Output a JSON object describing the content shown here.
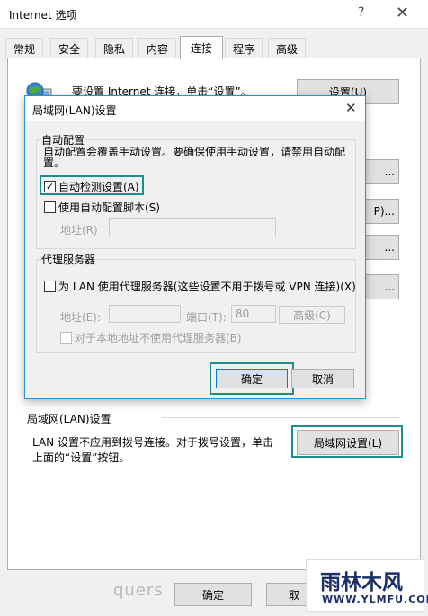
{
  "outer_window": {
    "title": "Internet 选项",
    "help_glyph": "?",
    "close_glyph": "✕"
  },
  "tabs": [
    "常规",
    "安全",
    "隐私",
    "内容",
    "连接",
    "程序",
    "高级"
  ],
  "active_tab": "连接",
  "setup": {
    "text": "要设置 Internet 连接，单击“设置”。",
    "button": "设置(U)"
  },
  "edge_buttons": [
    "...",
    "P)...",
    "...",
    "..."
  ],
  "lan_section": {
    "title": "局域网(LAN)设置",
    "description": "LAN 设置不应用到拨号连接。对于拨号设置，单击上面的“设置”按钮。",
    "button": "局域网设置(L)"
  },
  "outer_buttons": {
    "ok": "确定",
    "cancel": "取"
  },
  "watermark": {
    "quers": "quers",
    "logo": "雨林木风",
    "url": "WWW.YLMFU.COM"
  },
  "lan_dialog": {
    "title": "局域网(LAN)设置",
    "close_glyph": "✕",
    "auto_config": {
      "group_title": "自动配置",
      "description": "自动配置会覆盖手动设置。要确保使用手动设置，请禁用自动配置。",
      "auto_detect": {
        "label": "自动检测设置(A)",
        "checked": true,
        "mark": "✓"
      },
      "use_script": {
        "label": "使用自动配置脚本(S)",
        "checked": false
      },
      "address_label": "地址(R)",
      "address_value": ""
    },
    "proxy": {
      "group_title": "代理服务器",
      "use_proxy": {
        "label": "为 LAN 使用代理服务器(这些设置不用于拨号或 VPN 连接)(X)",
        "checked": false
      },
      "address_label": "地址(E):",
      "address_value": "",
      "port_label": "端口(T):",
      "port_value": "80",
      "advanced_button": "高级(C)",
      "bypass_local": {
        "label": "对于本地地址不使用代理服务器(B)",
        "checked": false
      }
    },
    "ok_button": "确定",
    "cancel_button": "取消"
  },
  "colors": {
    "highlight": "#1e8c93",
    "dialog_border": "#2b91d6",
    "logo": "#1b2f68"
  }
}
